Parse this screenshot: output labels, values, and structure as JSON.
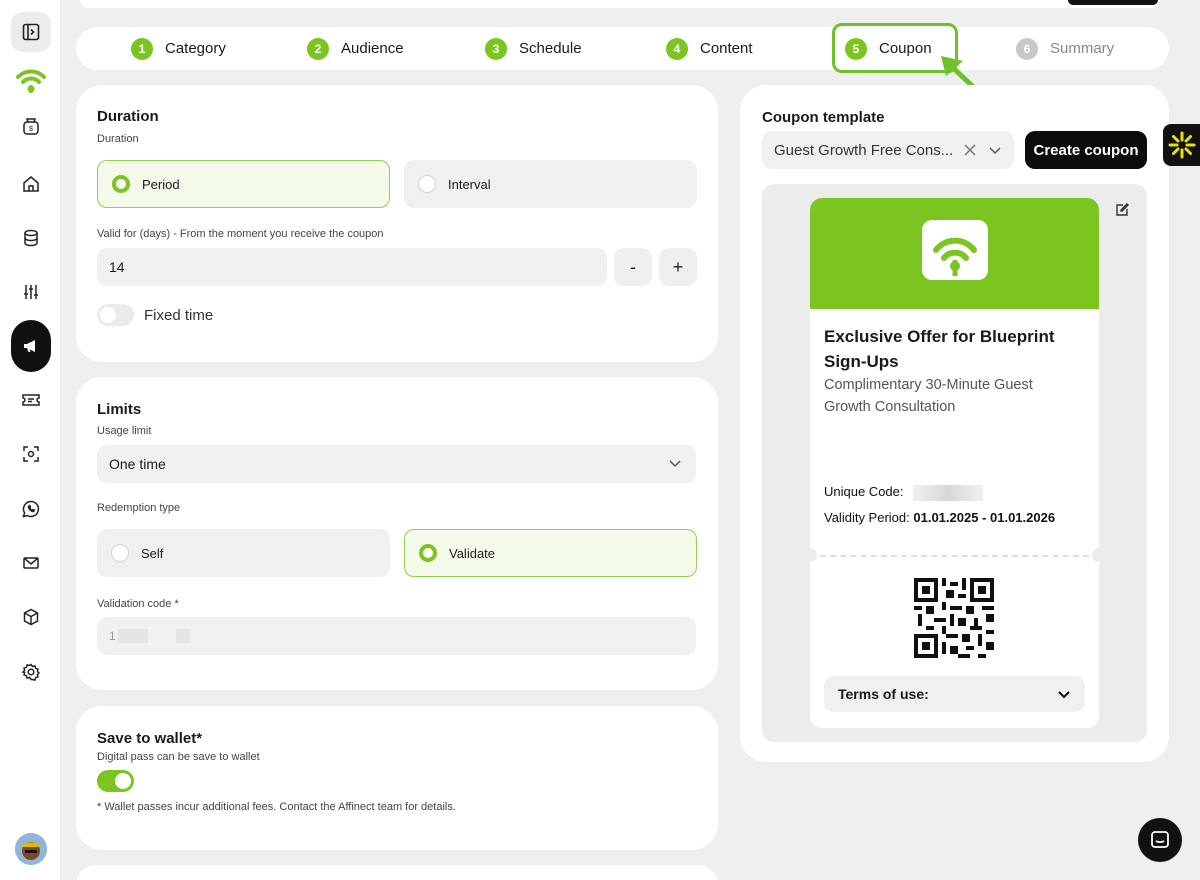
{
  "stepper": {
    "steps": [
      {
        "num": "1",
        "label": "Category"
      },
      {
        "num": "2",
        "label": "Audience"
      },
      {
        "num": "3",
        "label": "Schedule"
      },
      {
        "num": "4",
        "label": "Content"
      },
      {
        "num": "5",
        "label": "Coupon"
      },
      {
        "num": "6",
        "label": "Summary"
      }
    ]
  },
  "duration": {
    "title": "Duration",
    "sublabel": "Duration",
    "option_period": "Period",
    "option_interval": "Interval",
    "valid_label": "Valid for (days) - From the moment you receive the coupon",
    "valid_value": "14",
    "minus": "-",
    "plus": "+",
    "fixed_time_label": "Fixed time"
  },
  "limits": {
    "title": "Limits",
    "usage_label": "Usage limit",
    "usage_value": "One time",
    "redemption_label": "Redemption type",
    "option_self": "Self",
    "option_validate": "Validate",
    "validation_label": "Validation code *",
    "validation_value": "1"
  },
  "wallet": {
    "title": "Save to wallet*",
    "sublabel": "Digital pass can be save to wallet",
    "note": "* Wallet passes incur additional fees. Contact the Affinect team for details."
  },
  "coupon_panel": {
    "template_label": "Coupon template",
    "template_value": "Guest Growth Free Cons...",
    "create_button": "Create coupon",
    "coupon_title": "Exclusive Offer for Blueprint Sign-Ups",
    "coupon_subtitle": "Complimentary 30-Minute Guest Growth Consultation",
    "unique_code_label": "Unique Code:",
    "validity_label": "Validity Period:",
    "validity_value": "01.01.2025 - 01.01.2026",
    "terms_label": "Terms of use:"
  },
  "colors": {
    "accent_green": "#7cc520",
    "dark": "#111111"
  }
}
